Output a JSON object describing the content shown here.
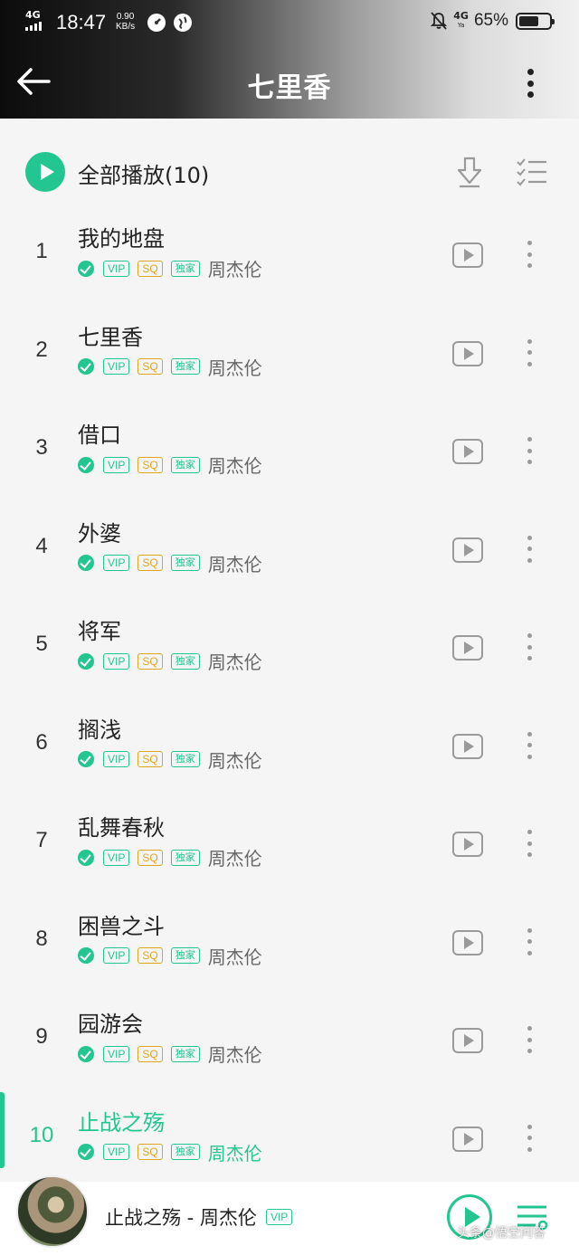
{
  "status": {
    "network": "4G",
    "time": "18:47",
    "speed_value": "0.90",
    "speed_unit": "KB/s",
    "network_right": "4G",
    "network_right_sub": "Ya",
    "battery_text": "65%",
    "battery_level": 0.65
  },
  "header": {
    "title": "七里香",
    "icons": [
      "back-arrow-icon",
      "more-vertical-icon"
    ]
  },
  "play_all": {
    "label": "全部播放(10)",
    "icons": [
      "play-circle-icon",
      "download-icon",
      "multi-select-icon"
    ]
  },
  "tags": {
    "vip": "VIP",
    "sq": "SQ",
    "exclusive": "独家"
  },
  "songs": [
    {
      "num": "1",
      "name": "我的地盘",
      "artist": "周杰伦"
    },
    {
      "num": "2",
      "name": "七里香",
      "artist": "周杰伦"
    },
    {
      "num": "3",
      "name": "借口",
      "artist": "周杰伦"
    },
    {
      "num": "4",
      "name": "外婆",
      "artist": "周杰伦"
    },
    {
      "num": "5",
      "name": "将军",
      "artist": "周杰伦"
    },
    {
      "num": "6",
      "name": "搁浅",
      "artist": "周杰伦"
    },
    {
      "num": "7",
      "name": "乱舞春秋",
      "artist": "周杰伦"
    },
    {
      "num": "8",
      "name": "困兽之斗",
      "artist": "周杰伦"
    },
    {
      "num": "9",
      "name": "园游会",
      "artist": "周杰伦"
    },
    {
      "num": "10",
      "name": "止战之殇",
      "artist": "周杰伦",
      "active": true
    }
  ],
  "now_playing": {
    "text": "止战之殇 - 周杰伦",
    "tag": "VIP"
  },
  "watermark": "头条@悟空问答",
  "colors": {
    "accent": "#23c591",
    "sq": "#e0a421",
    "background": "#f5f5f5"
  }
}
